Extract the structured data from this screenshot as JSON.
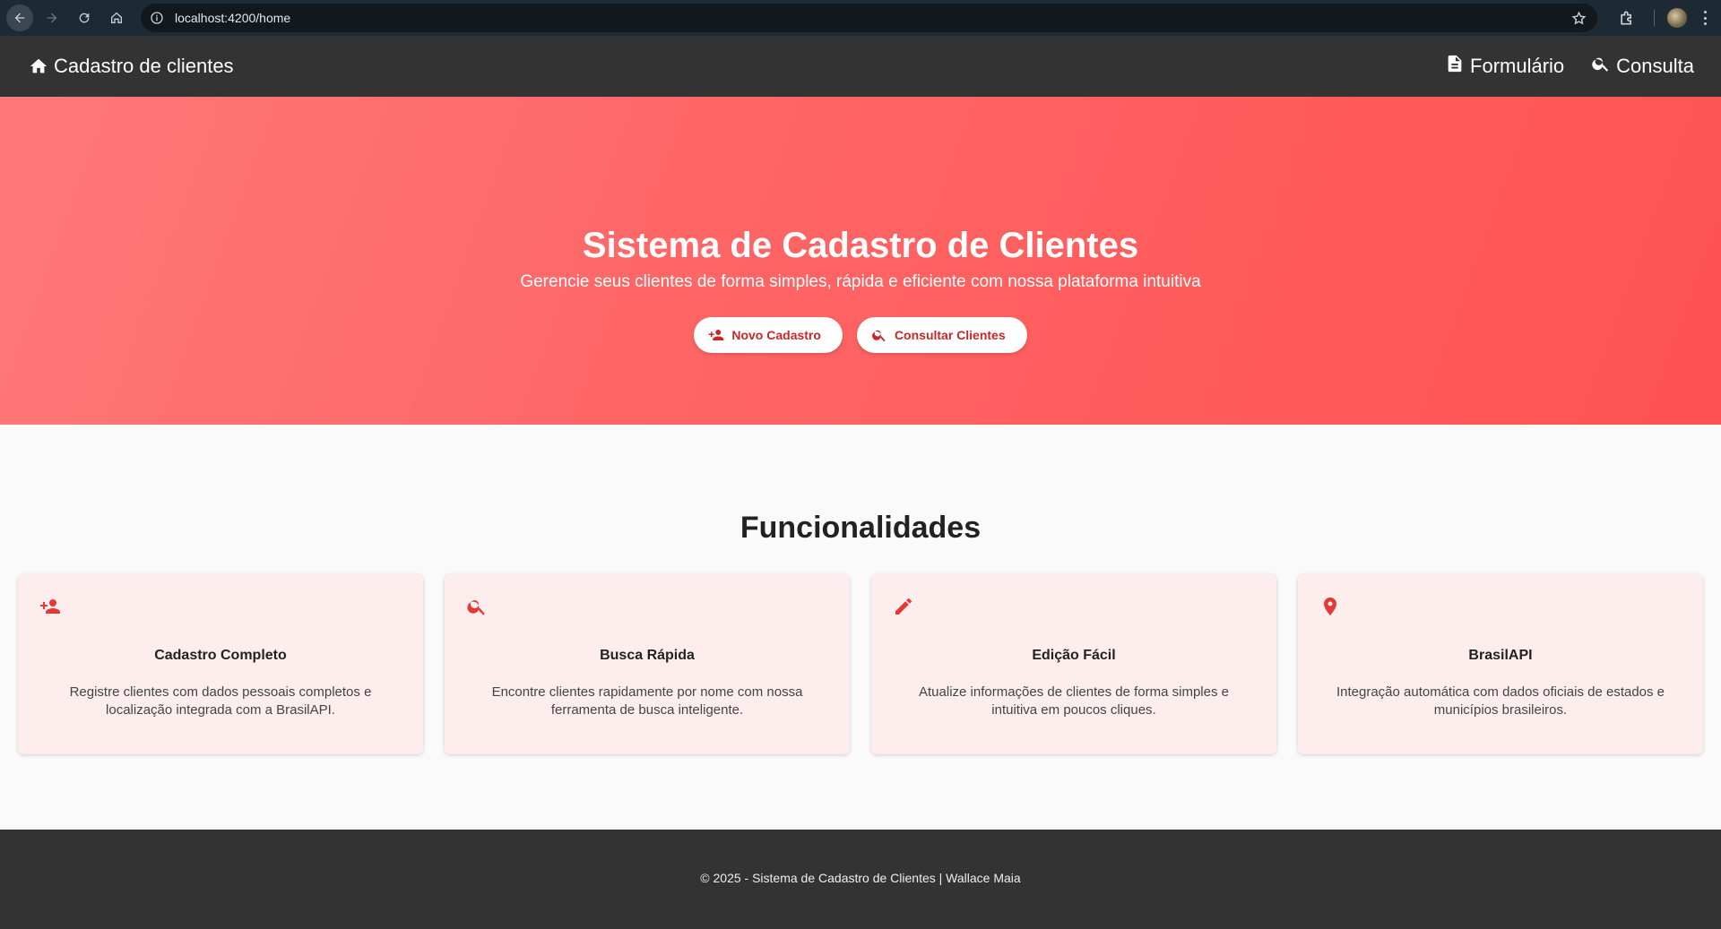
{
  "browser": {
    "url": "localhost:4200/home"
  },
  "toolbar": {
    "brand_label": "Cadastro de clientes",
    "nav": [
      {
        "label": "Formulário",
        "icon": "description-icon"
      },
      {
        "label": "Consulta",
        "icon": "search-icon"
      }
    ]
  },
  "hero": {
    "title": "Sistema de Cadastro de Clientes",
    "subtitle": "Gerencie seus clientes de forma simples, rápida e eficiente com nossa plataforma intuitiva",
    "primary_button": "Novo Cadastro",
    "secondary_button": "Consultar Clientes"
  },
  "features": {
    "title": "Funcionalidades",
    "cards": [
      {
        "icon": "person-add-icon",
        "title": "Cadastro Completo",
        "description": "Registre clientes com dados pessoais completos e localização integrada com a BrasilAPI."
      },
      {
        "icon": "search-icon",
        "title": "Busca Rápida",
        "description": "Encontre clientes rapidamente por nome com nossa ferramenta de busca inteligente."
      },
      {
        "icon": "edit-icon",
        "title": "Edição Fácil",
        "description": "Atualize informações de clientes de forma simples e intuitiva em poucos cliques."
      },
      {
        "icon": "location-pin-icon",
        "title": "BrasilAPI",
        "description": "Integração automática com dados oficiais de estados e municípios brasileiros."
      }
    ]
  },
  "footer": {
    "text": "© 2025 - Sistema de Cadastro de Clientes | Wallace Maia"
  },
  "colors": {
    "accent": "#ff5252",
    "toolbar": "#333333",
    "card_bg": "#fdeeed",
    "icon": "#e53935"
  }
}
